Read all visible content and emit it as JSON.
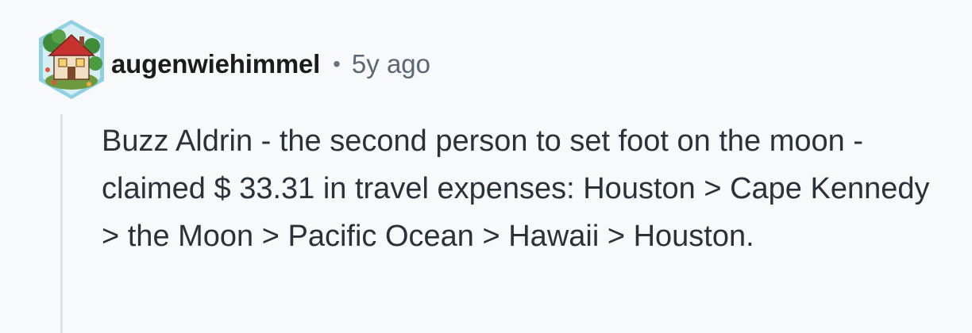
{
  "comment": {
    "username": "augenwiehimmel",
    "separator": "•",
    "timestamp": "5y ago",
    "body": "Buzz Aldrin - the second person to set foot on the moon - claimed $ 33.31 in travel expenses: Houston > Cape Kennedy > the Moon > Pacific Ocean > Hawaii > Houston.",
    "avatar_icon": "house-avatar-icon"
  },
  "colors": {
    "background": "#f8f9fb",
    "username": "#1c1c1c",
    "timestamp": "#5a6775",
    "body_text": "#2a3138",
    "thread_line": "#dde3ea",
    "avatar_frame": "#7fc6dc"
  }
}
